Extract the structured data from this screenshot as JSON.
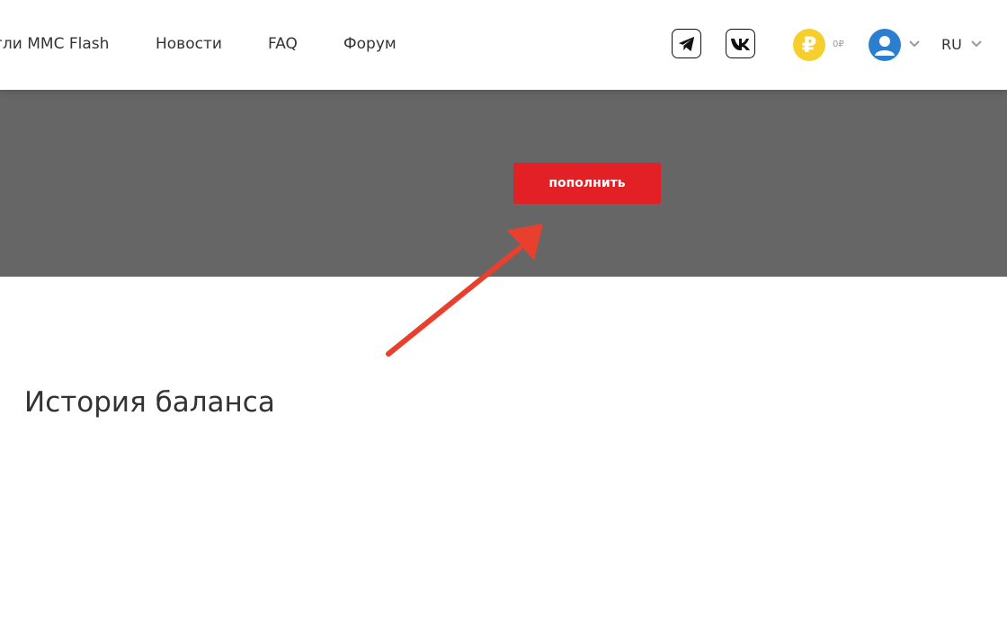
{
  "header": {
    "nav": [
      {
        "label": "гли MMC Flash"
      },
      {
        "label": "Новости"
      },
      {
        "label": "FAQ"
      },
      {
        "label": "Форум"
      }
    ],
    "social": [
      "telegram-icon",
      "vk-icon"
    ],
    "currency_symbol": "₽",
    "balance": "0₽",
    "language": "RU"
  },
  "banner": {
    "topup_label": "пополнить"
  },
  "history": {
    "title": "История баланса"
  },
  "colors": {
    "accent": "#e32025",
    "banner_bg": "#666666",
    "coin": "#f6cf2c",
    "avatar": "#2c7fce",
    "annotation_arrow": "#e8402d"
  }
}
